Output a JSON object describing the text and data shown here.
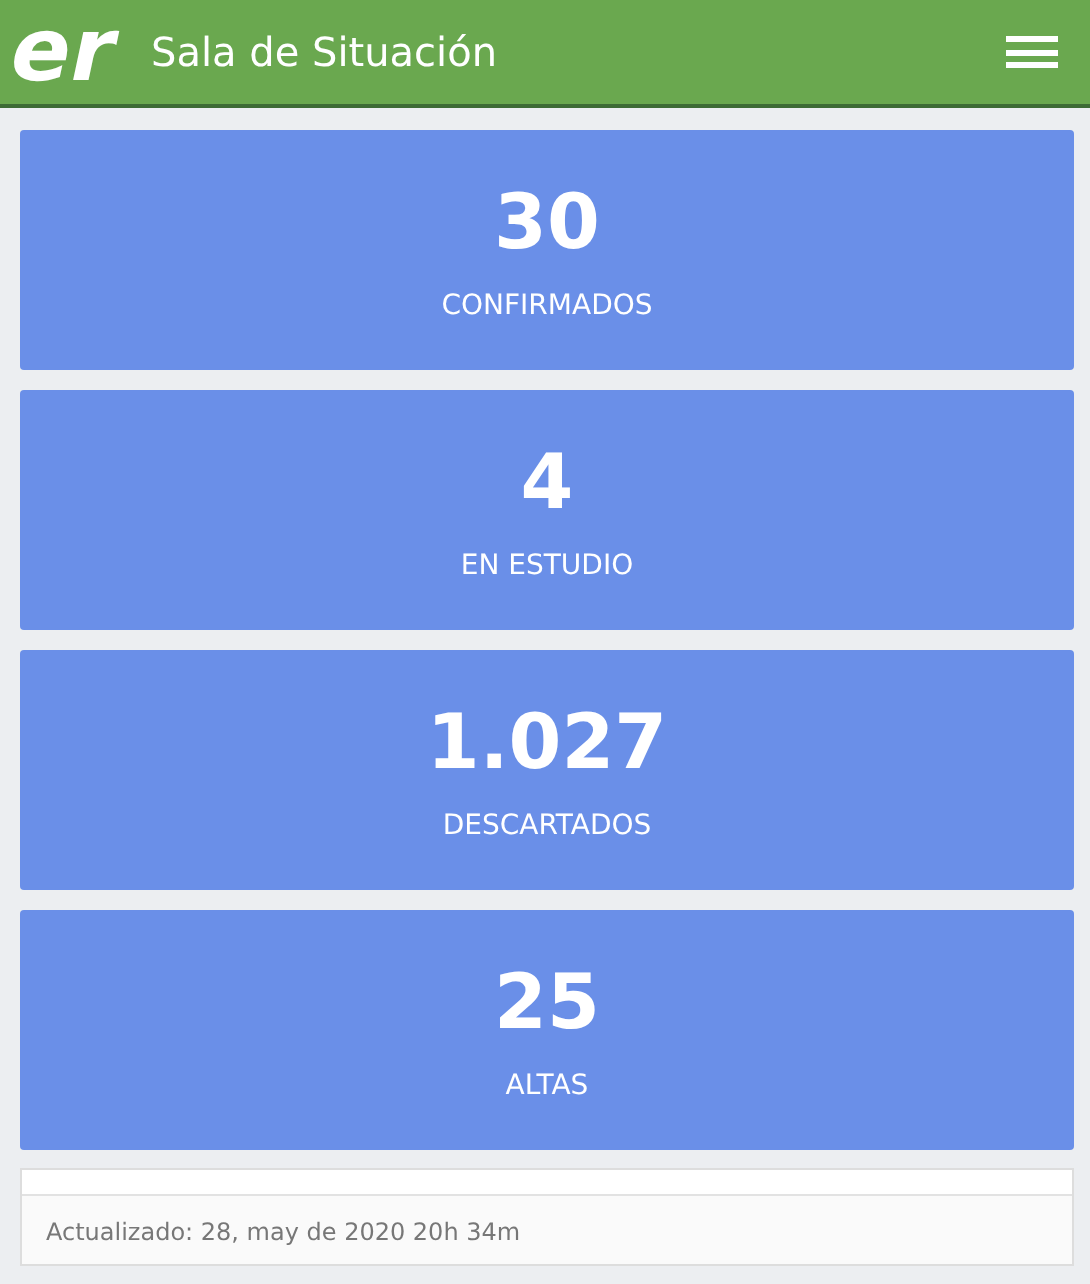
{
  "header": {
    "logo": "er",
    "title": "Sala de Situación"
  },
  "stats": [
    {
      "value": "30",
      "label": "CONFIRMADOS"
    },
    {
      "value": "4",
      "label": "EN ESTUDIO"
    },
    {
      "value": "1.027",
      "label": "DESCARTADOS"
    },
    {
      "value": "25",
      "label": "ALTAS"
    }
  ],
  "footer": {
    "updated": "Actualizado: 28, may de 2020 20h 34m"
  }
}
